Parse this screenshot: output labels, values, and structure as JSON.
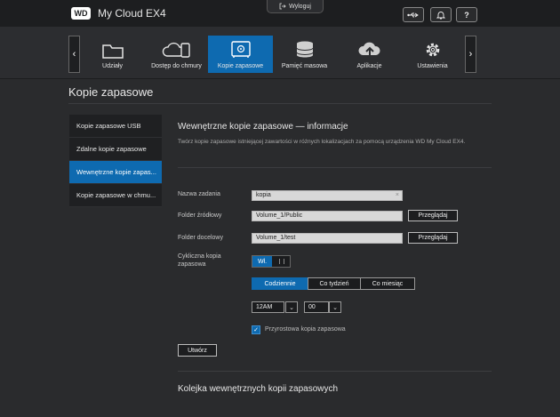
{
  "header": {
    "logo_text": "WD",
    "app_title": "My Cloud EX4",
    "logout_label": "Wyloguj",
    "icons": [
      "usb-icon",
      "bell-icon",
      "help-icon"
    ],
    "help_glyph": "?"
  },
  "nav": {
    "items": [
      {
        "label": "Udziały",
        "icon": "folder-icon"
      },
      {
        "label": "Dostęp do chmury",
        "icon": "cloud-device-icon"
      },
      {
        "label": "Kopie zapasowe",
        "icon": "safe-icon",
        "active": true
      },
      {
        "label": "Pamięć masowa",
        "icon": "storage-stack-icon"
      },
      {
        "label": "Aplikacje",
        "icon": "app-cloud-icon"
      },
      {
        "label": "Ustawienia",
        "icon": "gear-icon"
      }
    ],
    "left_arrow": "‹",
    "right_arrow": "›"
  },
  "page_title": "Kopie zapasowe",
  "sidebar": {
    "items": [
      {
        "label": "Kopie zapasowe USB"
      },
      {
        "label": "Zdalne kopie zapasowe"
      },
      {
        "label": "Wewnętrzne kopie zapas...",
        "active": true
      },
      {
        "label": "Kopie zapasowe w chmu..."
      }
    ]
  },
  "main": {
    "section_title": "Wewnętrzne kopie zapasowe — informacje",
    "description": "Twórz kopie zapasowe istniejącej zawartości w różnych lokalizacjach za pomocą urządzenia WD My Cloud EX4.",
    "task_name": {
      "label": "Nazwa zadania",
      "value": "kopia",
      "clear_glyph": "×"
    },
    "source_folder": {
      "label": "Folder źródłowy",
      "value": "Volume_1/Public",
      "browse_label": "Przeglądaj"
    },
    "dest_folder": {
      "label": "Folder docelowy",
      "value": "Volume_1/test",
      "browse_label": "Przeglądaj"
    },
    "recurring": {
      "label": "Cykliczna kopia zapasowa",
      "toggle_on_label": "Wł."
    },
    "frequency": {
      "options": [
        "Codziennie",
        "Co tydzień",
        "Co miesiąc"
      ],
      "selected": "Codziennie"
    },
    "time": {
      "hour": "12AM",
      "minute": "00",
      "arrow_glyph": "⌄"
    },
    "incremental": {
      "label": "Przyrostowa kopia zapasowa",
      "checked": true,
      "check_glyph": "✓"
    },
    "create_label": "Utwórz",
    "queue_title": "Kolejka wewnętrznych kopii zapasowych"
  },
  "colors": {
    "accent": "#0e6ab0",
    "background": "#2a2b2d",
    "header": "#1d1e20"
  }
}
